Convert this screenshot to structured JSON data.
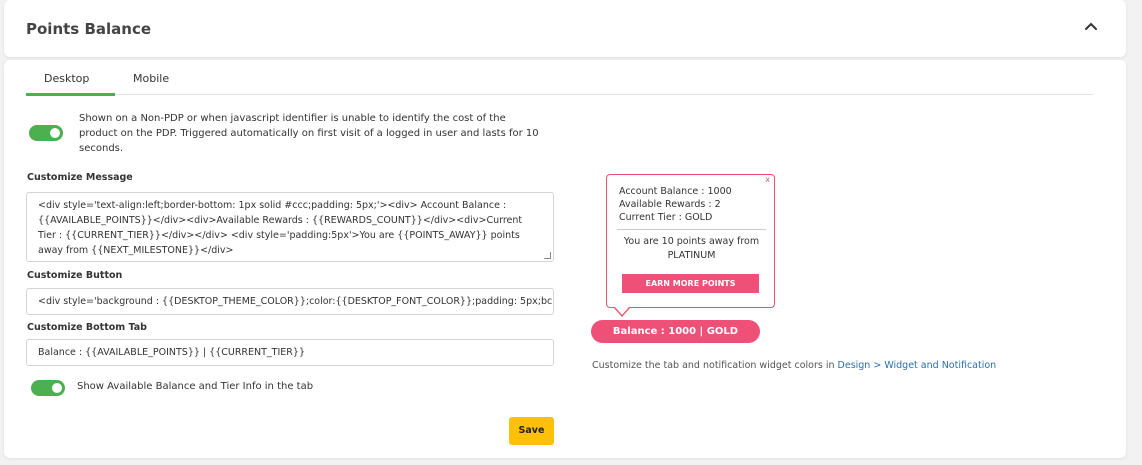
{
  "header": {
    "title": "Points Balance"
  },
  "tabs": [
    {
      "label": "Desktop",
      "active": true
    },
    {
      "label": "Mobile",
      "active": false
    }
  ],
  "display_toggle": {
    "enabled": true,
    "description": "Shown on a Non-PDP or when javascript identifier is unable to identify the cost of the product on the PDP. Triggered automatically on first visit of a logged in user and lasts for 10 seconds."
  },
  "customize_message": {
    "label": "Customize Message",
    "value": "<div style='text-align:left;border-bottom: 1px solid #ccc;padding: 5px;'><div>    Account Balance : {{AVAILABLE_POINTS}}</div><div>Available Rewards : {{REWARDS_COUNT}}</div><div>Current Tier : {{CURRENT_TIER}}</div></div> <div style='padding:5px'>You are {{POINTS_AWAY}} points away from {{NEXT_MILESTONE}}</div>"
  },
  "customize_button": {
    "label": "Customize Button",
    "value": "<div style='background : {{DESKTOP_THEME_COLOR}};color:{{DESKTOP_FONT_COLOR}};padding: 5px;bc"
  },
  "customize_bottom_tab": {
    "label": "Customize Bottom Tab",
    "value": "Balance : {{AVAILABLE_POINTS}} | {{CURRENT_TIER}}"
  },
  "show_info_toggle": {
    "enabled": true,
    "label": "Show Available Balance and Tier Info in the tab"
  },
  "save_label": "Save",
  "preview": {
    "close": "x",
    "account_balance": "Account Balance : 1000",
    "available_rewards": "Available Rewards : 2",
    "current_tier": "Current Tier : GOLD",
    "points_away": "You are 10 points away from PLATINUM",
    "earn_button": "EARN MORE POINTS",
    "balance_tab": "Balance : 1000 | GOLD"
  },
  "customize_note": {
    "text": "Customize the tab and notification widget colors in ",
    "link": "Design > Widget and Notification"
  },
  "colors": {
    "accent_green": "#4caf50",
    "brand_pink": "#ee5078",
    "save_yellow": "#ffc107",
    "link_blue": "#2a6fb0"
  }
}
